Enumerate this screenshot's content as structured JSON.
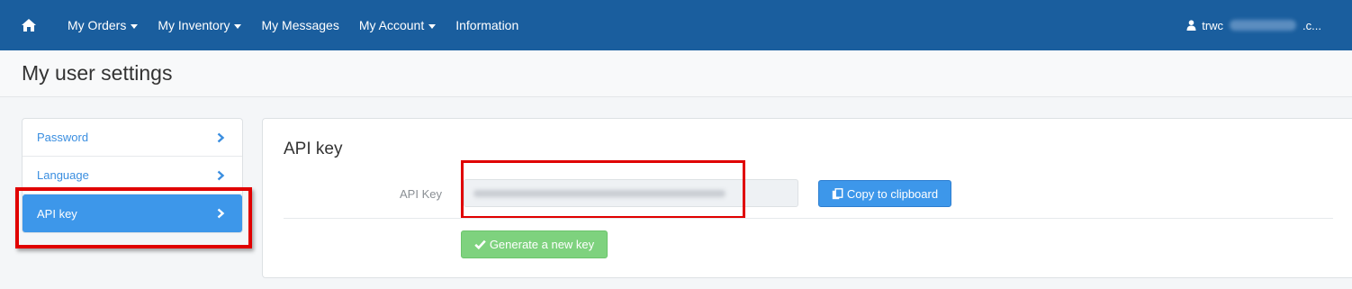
{
  "navbar": {
    "home_icon": "home-icon",
    "items": [
      {
        "label": "My Orders",
        "dropdown": true
      },
      {
        "label": "My Inventory",
        "dropdown": true
      },
      {
        "label": "My Messages",
        "dropdown": false
      },
      {
        "label": "My Account",
        "dropdown": true
      },
      {
        "label": "Information",
        "dropdown": false
      }
    ],
    "user": {
      "icon": "user-icon",
      "prefix": "trwc",
      "suffix": ".c..."
    }
  },
  "page": {
    "title": "My user settings"
  },
  "sidebar": {
    "items": [
      {
        "label": "Password",
        "active": false
      },
      {
        "label": "Language",
        "active": false
      },
      {
        "label": "API key",
        "active": true
      }
    ]
  },
  "panel": {
    "title": "API key",
    "field_label": "API Key",
    "copy_button": "Copy to clipboard",
    "generate_button": "Generate a new key"
  },
  "colors": {
    "navbar": "#1a5e9e",
    "accent": "#3d97ea",
    "success": "#7ed27e",
    "highlight": "#e00000"
  }
}
